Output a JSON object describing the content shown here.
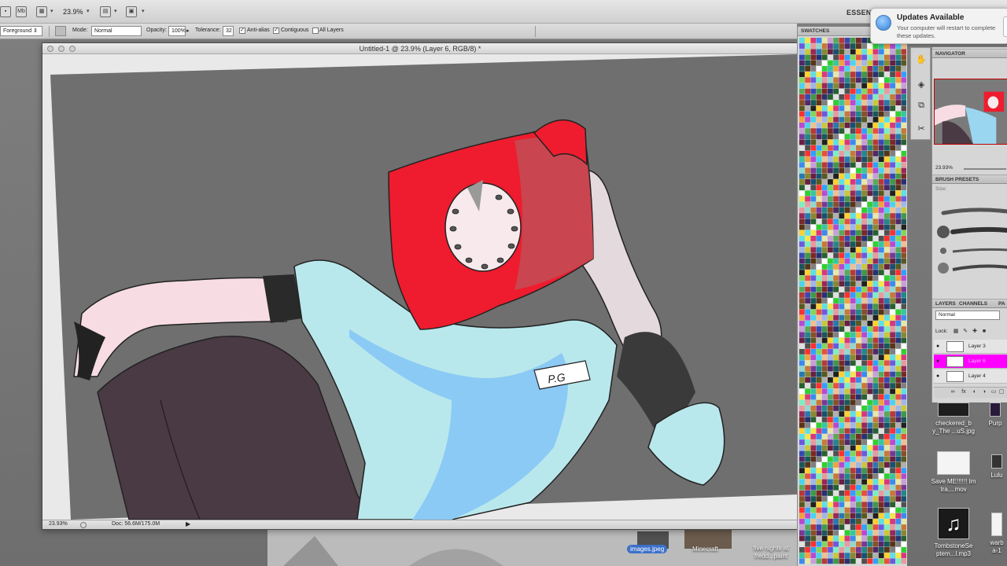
{
  "app_bar": {
    "zoom": "23.9%",
    "workspace": "ESSENT"
  },
  "options_bar": {
    "tool_preset": "Foreground",
    "mode_label": "Mode:",
    "mode_value": "Normal",
    "opacity_label": "Opacity:",
    "opacity_value": "100%",
    "tolerance_label": "Tolerance:",
    "tolerance_value": "32",
    "antialias_label": "Anti-alias",
    "contiguous_label": "Contiguous",
    "all_layers_label": "All Layers"
  },
  "document": {
    "title": "Untitled-1 @ 23.9% (Layer 6, RGB/8) *",
    "status_zoom": "23.93%",
    "status_doc": "Doc: 56.6M/175.0M",
    "artwork": {
      "badge_text": "P.G"
    }
  },
  "swatches": {
    "tab_label": "SWATCHES",
    "colors": [
      "#5ce1e6",
      "#38c6a0",
      "#82d65a",
      "#f5e74a",
      "#f0a23c",
      "#e8503c",
      "#d8387a",
      "#b84ad0",
      "#6a5ae0",
      "#3a8af0",
      "#48d4f0",
      "#7af0c0",
      "#e7e7a8",
      "#f0c090",
      "#e89aa0",
      "#c8a0d8",
      "#a0b8e8",
      "#90d8d0",
      "#58aa58",
      "#c8c838",
      "#c87838",
      "#b83838",
      "#982858",
      "#783898",
      "#3848b0",
      "#2878b0",
      "#208888",
      "#409848",
      "#888830",
      "#885028",
      "#7a2828",
      "#682040",
      "#502868",
      "#283070",
      "#185070",
      "#185858",
      "#286030",
      "#585820",
      "#583418",
      "#e0e0e0",
      "#b0b0b0",
      "#808080",
      "#505050",
      "#202020",
      "#ffffff",
      "#ff3030",
      "#ffd030",
      "#30d030",
      "#30a0ff"
    ]
  },
  "tools": [
    "hand-icon",
    "palette-icon",
    "layer-comp-icon",
    "tools-icon"
  ],
  "right_panels": {
    "navigator_tab": "NAVIGATOR",
    "navigator_zoom": "23.93%",
    "brush_presets_tab": "BRUSH PRESETS",
    "size_label": "Size:",
    "layers_tab": "LAYERS",
    "channels_tab": "CHANNELS",
    "paths_tab": "PA",
    "blend_mode": "Normal",
    "lock_label": "Lock:",
    "layers": [
      {
        "name": "Layer 3",
        "selected": false
      },
      {
        "name": "Layer 6",
        "selected": true
      },
      {
        "name": "Layer 4",
        "selected": false
      }
    ]
  },
  "notification": {
    "title": "Updates Available",
    "body": "Your computer will restart to complete these updates."
  },
  "desktop_files": [
    {
      "label": "checkered_b y_The ...uS.jpg"
    },
    {
      "label": "Purp"
    },
    {
      "label": "Save ME!!!!!! Im tra....mov"
    },
    {
      "label": "Lulu"
    },
    {
      "label": "TombstoneSe ptem...l.mp3"
    },
    {
      "label": "warb a-1"
    },
    {
      "label": "images.jpeg"
    },
    {
      "label": "Minecraft"
    },
    {
      "label": "five nights at fredd...paint"
    }
  ]
}
